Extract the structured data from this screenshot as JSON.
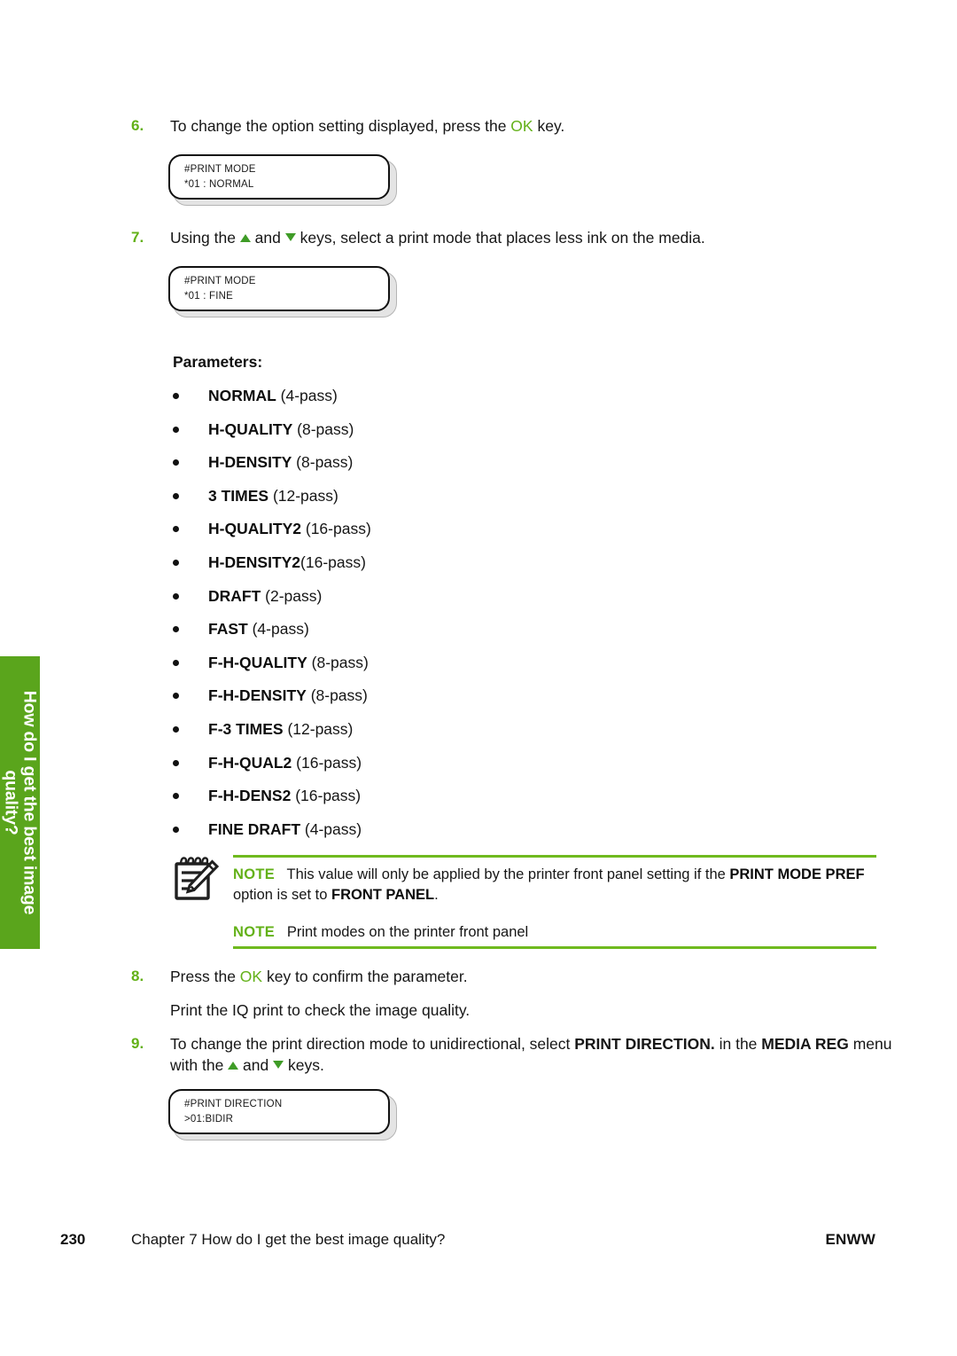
{
  "side_tab": {
    "label": "How do I get the best image quality?",
    "color": "#5aa51c"
  },
  "colors": {
    "accent_green": "#63b118",
    "tab_green": "#5aa51c",
    "rule_green": "#6fba1e",
    "arrow_green": "#3f9c27"
  },
  "steps": {
    "step6": {
      "number": "6.",
      "text_part1": "To change the option setting displayed, press the ",
      "ok_label": "OK",
      "text_part2": " key."
    },
    "step7": {
      "number": "7.",
      "text_part1": "Using the ",
      "text_part2": " and ",
      "text_part3": " keys, select a print mode that places less ink on the media."
    },
    "step8": {
      "number": "8.",
      "text_part1": "Press the ",
      "ok_label": "OK",
      "text_part2": " key to confirm the parameter.",
      "extra_line": "Print the IQ print to check the image quality."
    },
    "step9": {
      "number": "9.",
      "text_part1": "To change the print direction mode to unidirectional, select ",
      "bold1": "PRINT DIRECTION.",
      "text_part2": " in the ",
      "bold2": "MEDIA REG",
      "text_part3": "menu with the ",
      "text_part4": " and ",
      "text_part5": " keys."
    }
  },
  "lcd_displays": [
    {
      "id": "lcd-print-mode-normal",
      "line1": "#PRINT MODE",
      "line2": "*01 : NORMAL"
    },
    {
      "id": "lcd-print-mode-fine",
      "line1": "#PRINT MODE",
      "line2": "*01 : FINE"
    },
    {
      "id": "lcd-print-direction",
      "line1": "#PRINT DIRECTION",
      "line2": ">01:BIDIR"
    }
  ],
  "parameters": {
    "heading": "Parameters:",
    "items": [
      {
        "name": "NORMAL",
        "pass": " (4-pass)"
      },
      {
        "name": "H-QUALITY",
        "pass": " (8-pass)"
      },
      {
        "name": "H-DENSITY",
        "pass": " (8-pass)"
      },
      {
        "name": "3 TIMES",
        "pass": " (12-pass)"
      },
      {
        "name": "H-QUALITY2",
        "pass": " (16-pass)"
      },
      {
        "name": "H-DENSITY2",
        "pass": "(16-pass)"
      },
      {
        "name": "DRAFT",
        "pass": " (2-pass)"
      },
      {
        "name": "FAST",
        "pass": " (4-pass)"
      },
      {
        "name": "F-H-QUALITY",
        "pass": " (8-pass)"
      },
      {
        "name": "F-H-DENSITY",
        "pass": " (8-pass)"
      },
      {
        "name": "F-3 TIMES",
        "pass": " (12-pass)"
      },
      {
        "name": "F-H-QUAL2",
        "pass": " (16-pass)"
      },
      {
        "name": "F-H-DENS2",
        "pass": " (16-pass)"
      },
      {
        "name": "FINE DRAFT",
        "pass": " (4-pass)"
      }
    ]
  },
  "note_block": {
    "icon": "notepad-pencil-icon",
    "note1": {
      "tag": "NOTE",
      "text_part1": "This value will only be applied by the printer front panel setting if the ",
      "bold1": "PRINT MODE PREF",
      "text_part2": " option is set to  ",
      "bold2": "FRONT PANEL",
      "text_part3": "."
    },
    "note2": {
      "tag": "NOTE",
      "text": "Print modes on the printer front panel"
    }
  },
  "footer": {
    "page_number": "230",
    "chapter": "Chapter 7   How do I get the best image quality?",
    "brand": "ENWW"
  }
}
